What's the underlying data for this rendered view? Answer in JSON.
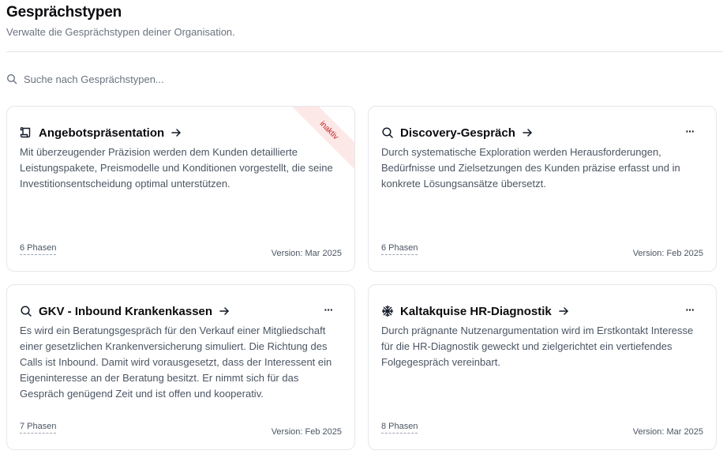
{
  "header": {
    "title": "Gesprächstypen",
    "subtitle": "Verwalte die Gesprächstypen deiner Organisation."
  },
  "search": {
    "placeholder": "Suche nach Gesprächstypen...",
    "icon": "search-icon"
  },
  "cards": [
    {
      "title": "Angebotspräsentation",
      "icon": "scroll-icon",
      "description": "Mit überzeugender Präzision werden dem Kunden detaillierte Leistungspakete, Preismodelle und Konditionen vorgestellt, die seine Investitionsentscheidung optimal unterstützen.",
      "phases": "6 Phasen",
      "version": "Version: Mar 2025",
      "badge": "inaktiv"
    },
    {
      "title": "Discovery-Gespräch",
      "icon": "search-icon",
      "description": "Durch systematische Exploration werden Herausforderungen, Bedürfnisse und Zielsetzungen des Kunden präzise erfasst und in konkrete Lösungsansätze übersetzt.",
      "phases": "6 Phasen",
      "version": "Version: Feb 2025",
      "more": "···"
    },
    {
      "title": "GKV - Inbound Krankenkassen",
      "icon": "search-icon",
      "description": "Es wird ein Beratungsgespräch für den Verkauf einer Mitgliedschaft einer gesetzlichen Krankenversicherung simuliert. Die Richtung des Calls ist Inbound. Damit wird vorausgesetzt, dass der Interessent ein Eigeninteresse an der Beratung besitzt. Er nimmt sich für das Gespräch genügend Zeit und ist offen und kooperativ.",
      "phases": "7 Phasen",
      "version": "Version: Feb 2025",
      "more": "···"
    },
    {
      "title": "Kaltakquise HR-Diagnostik",
      "icon": "snowflake-icon",
      "description": "Durch prägnante Nutzenargumentation wird im Erstkontakt Interesse für die HR-Diagnostik geweckt und zielgerichtet ein vertiefendes Folgegespräch vereinbart.",
      "phases": "8 Phasen",
      "version": "Version: Mar 2025",
      "more": "···"
    }
  ]
}
